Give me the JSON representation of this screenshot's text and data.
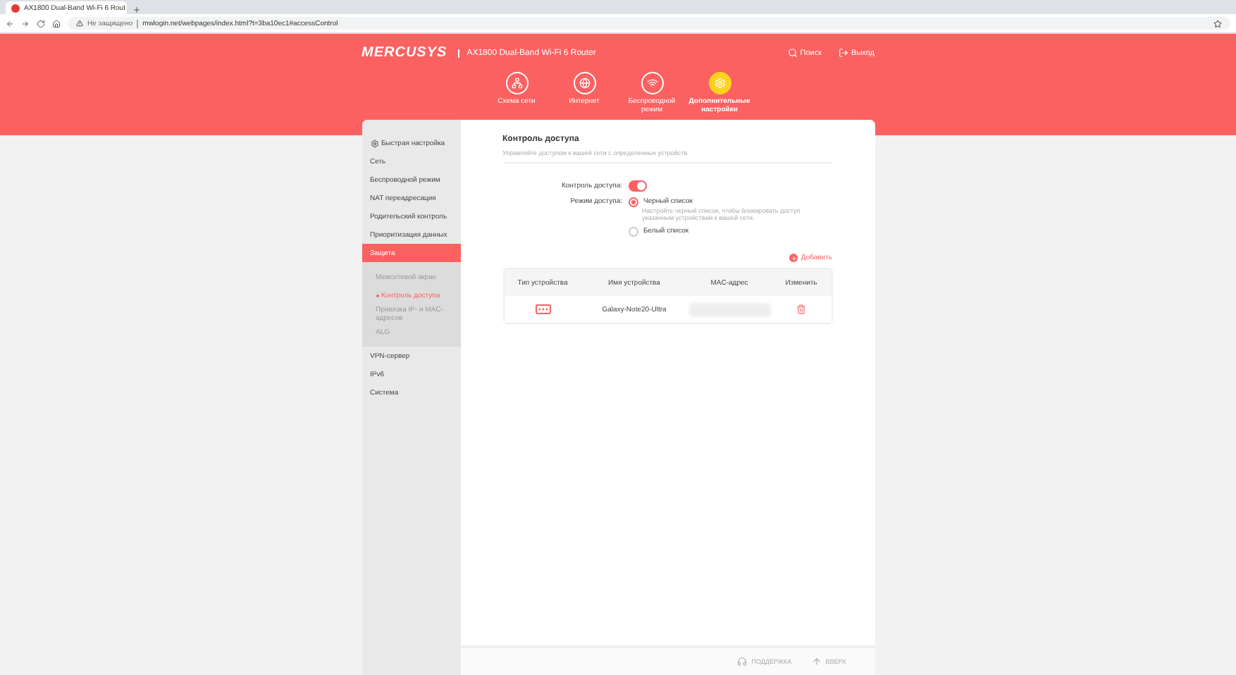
{
  "browser": {
    "tab_title": "AX1800 Dual-Band Wi-Fi 6 Rout",
    "security": "Не защищено",
    "url": "mwlogin.net/webpages/index.html?t=3ba10ec1#accessControl"
  },
  "header": {
    "logo": "MERCUSYS",
    "model": "AX1800 Dual-Band Wi-Fi 6 Router",
    "actions": [
      {
        "label": "Поиск",
        "kind": "search"
      },
      {
        "label": "Выход",
        "kind": "logout"
      }
    ]
  },
  "nav": [
    {
      "label": "Схема сети",
      "kind": "network",
      "selected": false
    },
    {
      "label": "Интернет",
      "kind": "internet",
      "selected": false
    },
    {
      "label": "Беспроводной режим",
      "kind": "wireless",
      "selected": false
    },
    {
      "label": "Дополнительные настройки",
      "kind": "advanced",
      "selected": true
    }
  ],
  "sidebar": [
    {
      "label": "Быстрая настройка",
      "kind": "quick",
      "selected": false
    },
    {
      "label": "Сеть",
      "selected": false
    },
    {
      "label": "Беспроводной режим",
      "selected": false
    },
    {
      "label": "NAT переадресация",
      "selected": false
    },
    {
      "label": "Родительский контроль",
      "selected": false
    },
    {
      "label": "Приоритизация данных",
      "selected": false
    },
    {
      "label": "Защита",
      "selected": true,
      "expanded": true,
      "children": [
        {
          "label": "Межсетевой экран",
          "selected": false
        },
        {
          "label": "Контроль доступа",
          "selected": true
        },
        {
          "label": "Привязка IP- и MAC-адресов",
          "selected": false
        },
        {
          "label": "ALG",
          "selected": false
        }
      ]
    },
    {
      "label": "VPN-сервер",
      "selected": false
    },
    {
      "label": "IPv6",
      "selected": false
    },
    {
      "label": "Система",
      "selected": false
    }
  ],
  "content": {
    "title": "Контроль доступа",
    "subtitle": "Управляйте доступом к вашей сети с определенных устройств.",
    "toggle": {
      "label": "Контроль доступа:",
      "on": true
    },
    "mode": {
      "label": "Режим доступа:",
      "options": [
        {
          "label": "Черный список",
          "selected": true,
          "hint": "Настройте черный список, чтобы блокировать доступ указанным устройствам к вашей сети."
        },
        {
          "label": "Белый список",
          "selected": false
        }
      ]
    },
    "add": "Добавить",
    "table": {
      "columns": [
        "Тип устройства",
        "Имя устройства",
        "MAC-адрес",
        "Изменить"
      ],
      "rows": [
        {
          "name": "Galaxy-Note20-Ultra"
        }
      ]
    }
  },
  "footer": [
    {
      "label": "ПОДДЕРЖКА",
      "kind": "support"
    },
    {
      "label": "ВВЕРХ",
      "kind": "top"
    }
  ]
}
